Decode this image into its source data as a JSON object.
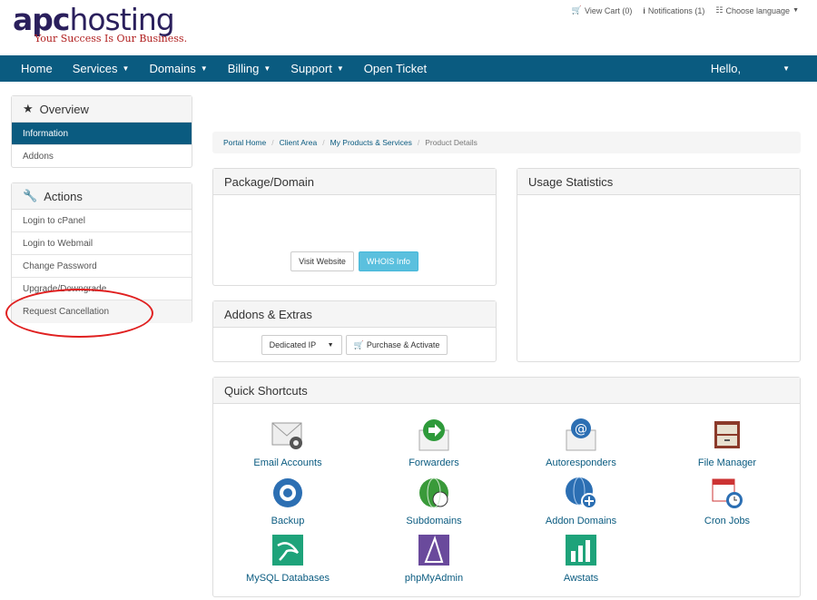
{
  "logo": {
    "brand_a": "apc",
    "brand_b": "hosting",
    "tagline": "Your Success Is Our Business."
  },
  "toplinks": {
    "cart": "View Cart (0)",
    "notifications": "Notifications (1)",
    "language": "Choose language"
  },
  "nav": {
    "items": [
      "Home",
      "Services",
      "Domains",
      "Billing",
      "Support",
      "Open Ticket"
    ],
    "hello": "Hello,"
  },
  "sidebar": {
    "overview": {
      "title": "Overview",
      "items": [
        "Information",
        "Addons"
      ]
    },
    "actions": {
      "title": "Actions",
      "items": [
        "Login to cPanel",
        "Login to Webmail",
        "Change Password",
        "Upgrade/Downgrade",
        "Request Cancellation"
      ]
    }
  },
  "breadcrumb": {
    "items": [
      "Portal Home",
      "Client Area",
      "My Products & Services"
    ],
    "current": "Product Details"
  },
  "package": {
    "title": "Package/Domain",
    "visit": "Visit Website",
    "whois": "WHOIS Info"
  },
  "addons": {
    "title": "Addons & Extras",
    "select": "Dedicated IP",
    "purchase": "Purchase & Activate"
  },
  "usage": {
    "title": "Usage Statistics"
  },
  "shortcuts": {
    "title": "Quick Shortcuts",
    "items": [
      "Email Accounts",
      "Forwarders",
      "Autoresponders",
      "File Manager",
      "Backup",
      "Subdomains",
      "Addon Domains",
      "Cron Jobs",
      "MySQL Databases",
      "phpMyAdmin",
      "Awstats"
    ]
  },
  "colors": {
    "nav": "#0a5b80",
    "info": "#5bc0de",
    "circle": "#e02020"
  }
}
